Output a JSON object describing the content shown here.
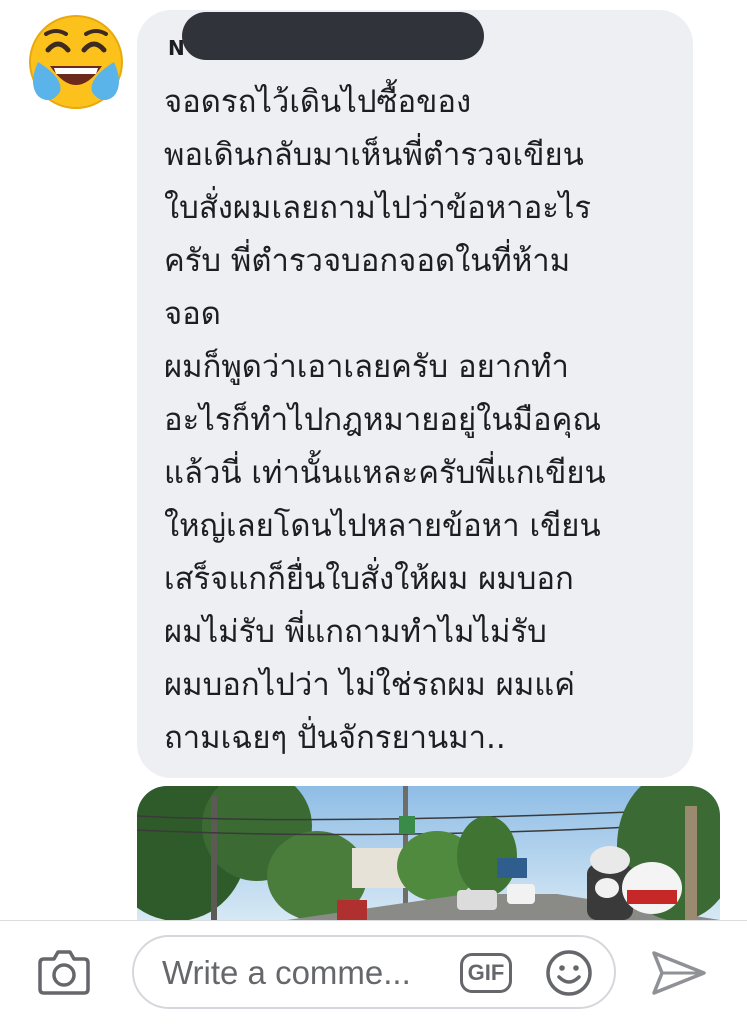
{
  "comment": {
    "author_initial": "N",
    "reaction_emoji": "face-with-tears-of-joy",
    "lines": [
      "จอดรถไว้เดินไปซื้อของ",
      "พอเดินกลับมาเห็นพี่ตำรวจเขียน",
      "ใบสั่งผมเลยถามไปว่าข้อหาอะไร",
      "ครับ พี่ตำรวจบอกจอดในที่ห้าม",
      "จอด",
      "ผมก็พูดว่าเอาเลยครับ อยากทำ",
      "อะไรก็ทำไปกฎหมายอยู่ในมือคุณ",
      "แล้วนี่ เท่านั้นแหละครับพี่แกเขียน",
      "ใหญ่เลยโดนไปหลายข้อหา เขียน",
      "เสร็จแกก็ยื่นใบสั่งให้ผม ผมบอก",
      "ผมไม่รับ พี่แกถามทำไมไม่รับ",
      "ผมบอกไปว่า ไม่ใช่รถผม ผมแค่",
      "ถามเฉยๆ ปั่นจักรยานมา.."
    ]
  },
  "composer": {
    "placeholder": "Write a comme...",
    "gif_label": "GIF",
    "camera_icon": "camera-icon",
    "emoji_icon": "smiley-icon",
    "send_icon": "send-icon"
  },
  "colors": {
    "bubble": "#eeeff3",
    "text": "#1c1e21",
    "icon_gray": "#65676b",
    "redaction": "#30343a"
  }
}
